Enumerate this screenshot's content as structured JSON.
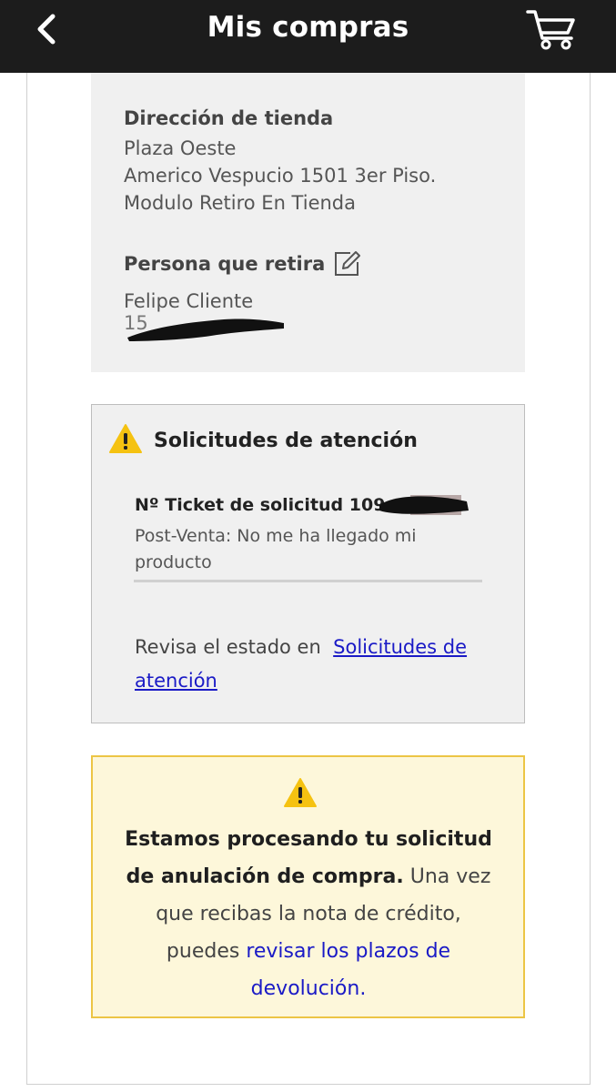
{
  "header": {
    "title": "Mis compras",
    "back_icon": "chevron-left-icon",
    "cart_icon": "cart-icon",
    "bg_color": "#1c1c1c"
  },
  "store": {
    "heading": "Dirección de tienda",
    "name": "Plaza Oeste",
    "address_line1": "Americo Vespucio 1501 3er Piso.",
    "address_line2": "Modulo Retiro En Tienda",
    "person_heading": "Persona que retira",
    "edit_icon": "edit-icon",
    "person_name": "Felipe Cliente",
    "person_id_visible": "15"
  },
  "requests": {
    "icon": "warning-icon",
    "title": "Solicitudes de atención",
    "ticket_label": "Nº Ticket de solicitud 109",
    "ticket_desc": "Post-Venta: No me ha llegado mi producto",
    "review_prefix": "Revisa el estado en",
    "review_link": "Solicitudes de atención"
  },
  "notice": {
    "icon": "warning-icon",
    "bold_text": "Estamos procesando tu solicitud de anulación de compra.",
    "plain_text": " Una vez que recibas la nota de crédito, puedes ",
    "link_text": "revisar los plazos de devolución.",
    "bg_color": "#fdf7da",
    "border_color": "#ecc545",
    "link_color": "#1a1ac6"
  }
}
